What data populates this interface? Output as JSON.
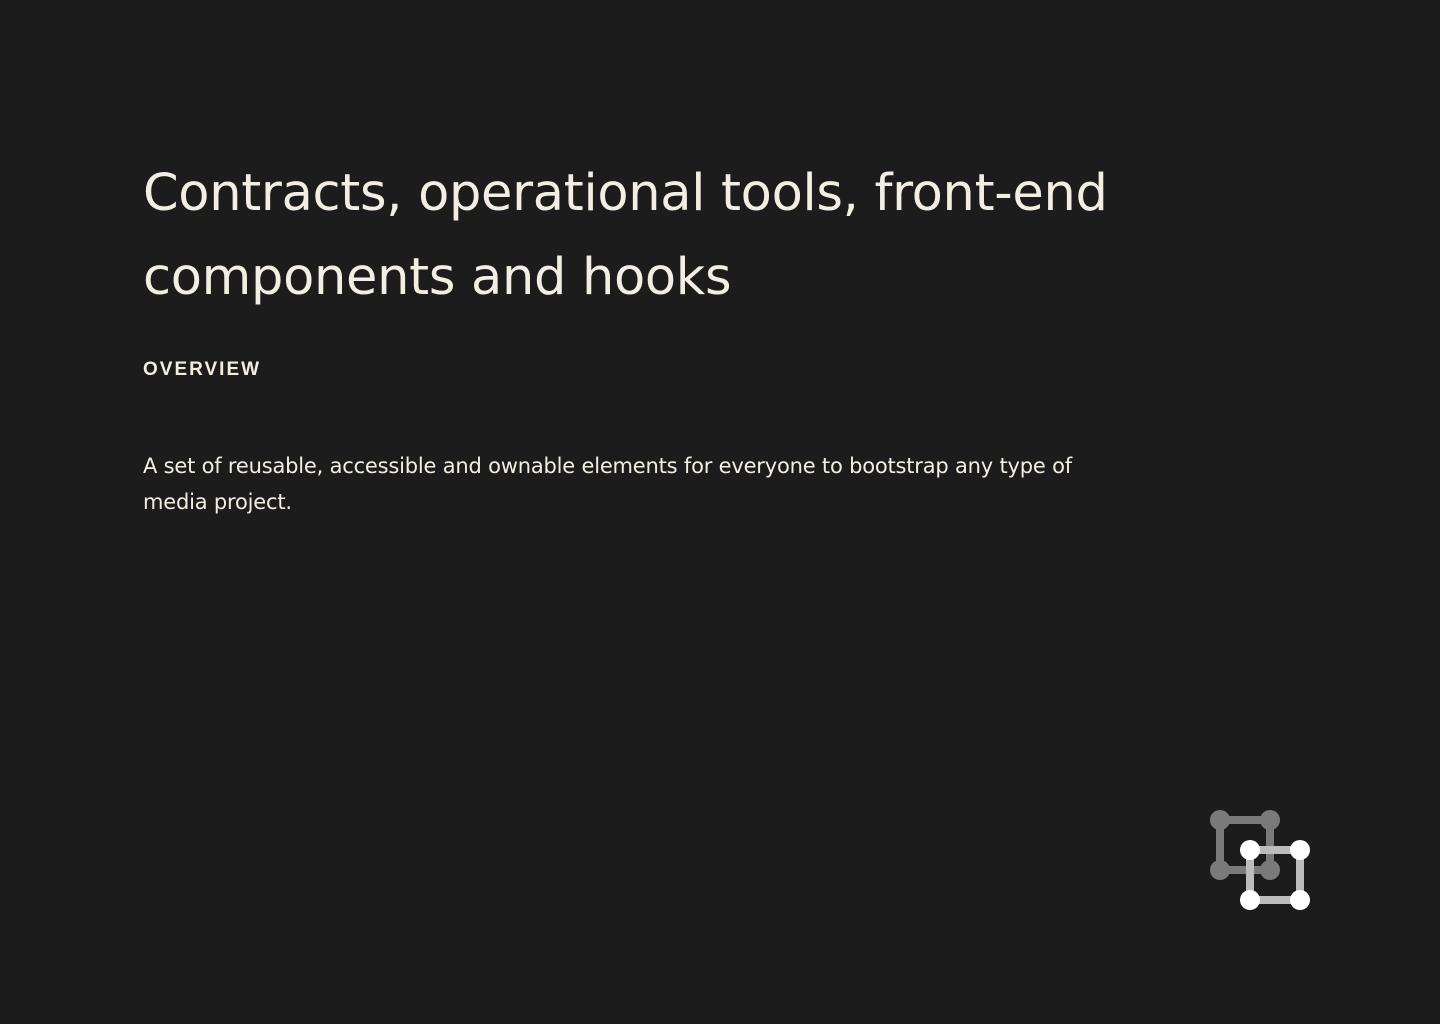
{
  "hero": {
    "title": "Contracts, operational tools, front-end components and hooks",
    "section_label": "OVERVIEW",
    "description": "A set of reusable, accessible and ownable elements for everyone to bootstrap any type of media project."
  },
  "logo": {
    "icon": "linked-squares-logo-icon",
    "back_color": "#7b7a7b",
    "front_color": "#ffffff"
  },
  "colors": {
    "background": "#1d1c1d",
    "text": "#f2eee3"
  }
}
